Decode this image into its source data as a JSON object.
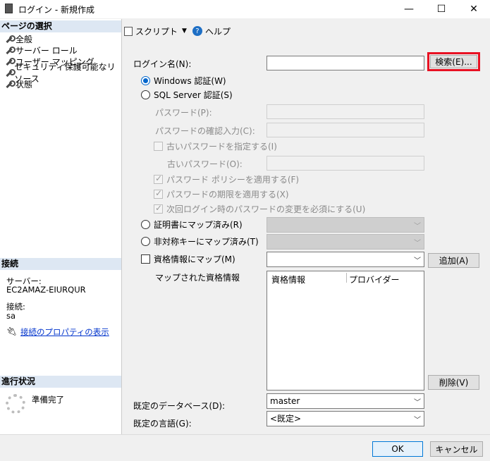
{
  "window": {
    "title": "ログイン - 新規作成",
    "minimize": "—",
    "maximize": "☐",
    "close": "✕"
  },
  "left": {
    "page_select_header": "ページの選択",
    "pages": [
      "全般",
      "サーバー ロール",
      "ユーザー マッピング",
      "セキュリティ保護可能なリソース",
      "状態"
    ],
    "connection_header": "接続",
    "server_label": "サーバー:",
    "server_value": "EC2AMAZ-EIURQUR",
    "conn_label": "接続:",
    "conn_value": "sa",
    "conn_props_link": "接続のプロパティの表示",
    "progress_header": "進行状況",
    "progress_status": "準備完了"
  },
  "toolbar": {
    "script": "スクリプト",
    "help": "ヘルプ"
  },
  "form": {
    "login_name_label": "ログイン名(N):",
    "login_name_value": "",
    "search_button": "検索(E)...",
    "win_auth": "Windows 認証(W)",
    "sql_auth": "SQL Server 認証(S)",
    "password": "パスワード(P):",
    "password_confirm": "パスワードの確認入力(C):",
    "old_password_check": "古いパスワードを指定する(I)",
    "old_password": "古いパスワード(O):",
    "policy": "パスワード ポリシーを適用する(F)",
    "expiration": "パスワードの期限を適用する(X)",
    "change_next": "次回ログイン時のパスワードの変更を必須にする(U)",
    "cert_map": "証明書にマップ済み(R)",
    "asym_map": "非対称キーにマップ済み(T)",
    "cred_map": "資格情報にマップ(M)",
    "add_button": "追加(A)",
    "mapped_creds": "マップされた資格情報",
    "grid_cols": [
      "資格情報",
      "プロバイダー"
    ],
    "remove_button": "削除(V)",
    "default_db_label": "既定のデータベース(D):",
    "default_db_value": "master",
    "default_lang_label": "既定の言語(G):",
    "default_lang_value": "<既定>"
  },
  "footer": {
    "ok": "OK",
    "cancel": "キャンセル"
  },
  "colors": {
    "highlight": "#e81123",
    "accent": "#0066cc",
    "section_bg": "#dde7f3"
  }
}
